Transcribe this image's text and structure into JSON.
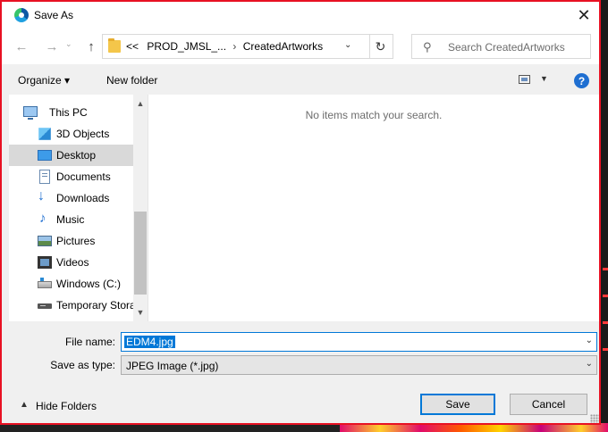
{
  "dialog": {
    "title": "Save As",
    "close_glyph": "✕"
  },
  "address": {
    "back_glyph": "←",
    "forward_glyph": "→",
    "recent_glyph": "⌄",
    "up_glyph": "↑",
    "overflow": "<<",
    "crumbs": [
      "PROD_JMSL_...",
      "CreatedArtworks"
    ],
    "crumb_sep": "›",
    "dropdown_glyph": "⌄",
    "refresh_glyph": "↻"
  },
  "search": {
    "icon_glyph": "⚲",
    "placeholder": "Search CreatedArtworks"
  },
  "toolbar": {
    "organize": "Organize ▾",
    "new_folder": "New folder",
    "view_drop": "▼",
    "help": "?"
  },
  "nav": {
    "items": [
      {
        "label": "This PC",
        "icon": "this-pc-icon"
      },
      {
        "label": "3D Objects",
        "icon": "cube-icon"
      },
      {
        "label": "Desktop",
        "icon": "desktop-icon",
        "selected": true
      },
      {
        "label": "Documents",
        "icon": "documents-icon"
      },
      {
        "label": "Downloads",
        "icon": "downloads-icon"
      },
      {
        "label": "Music",
        "icon": "music-icon"
      },
      {
        "label": "Pictures",
        "icon": "pictures-icon"
      },
      {
        "label": "Videos",
        "icon": "videos-icon"
      },
      {
        "label": "Windows (C:)",
        "icon": "drive-icon"
      },
      {
        "label": "Temporary Stora",
        "icon": "usb-drive-icon"
      }
    ],
    "scroll_up_glyph": "▲",
    "scroll_down_glyph": "▼"
  },
  "content": {
    "empty_message": "No items match your search."
  },
  "form": {
    "filename_label": "File name:",
    "filename_value": "EDM4.jpg",
    "savetype_label": "Save as type:",
    "savetype_value": "JPEG Image (*.jpg)",
    "dropdown_glyph": "⌄"
  },
  "footer": {
    "hide_folders_glyph": "▲",
    "hide_folders": "Hide Folders",
    "save": "Save",
    "cancel": "Cancel"
  },
  "colors": {
    "focus_border": "#e81123",
    "accent": "#0078d7",
    "selected_bg": "#d9d9d9"
  }
}
